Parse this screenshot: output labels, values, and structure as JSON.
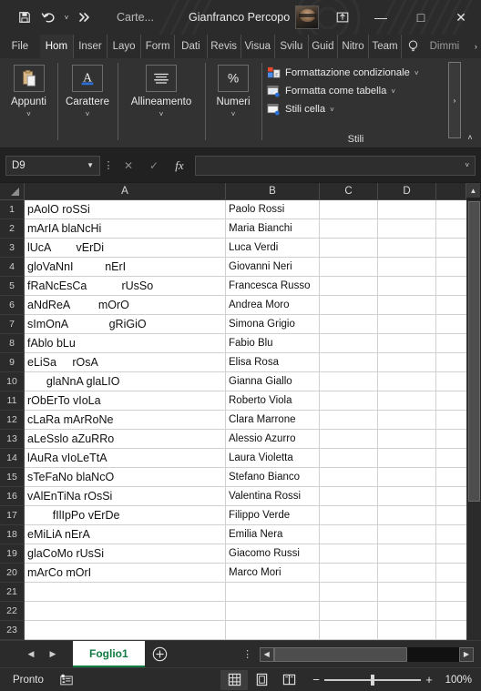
{
  "titlebar": {
    "save_icon": "save-icon",
    "undo_icon": "undo-icon",
    "undo_caret": "˅",
    "redo_icon": "redo-more-icon",
    "file_name": "Carte...",
    "user_name": "Gianfranco Percopo",
    "avatar": "user-avatar",
    "share_icon": "share-icon",
    "minimize": "—",
    "maximize": "□",
    "close": "✕"
  },
  "ribbon_tabs": {
    "items": [
      {
        "label": "File",
        "selected": false
      },
      {
        "label": "Hom",
        "selected": true
      },
      {
        "label": "Inser",
        "selected": false
      },
      {
        "label": "Layo",
        "selected": false
      },
      {
        "label": "Form",
        "selected": false
      },
      {
        "label": "Dati",
        "selected": false
      },
      {
        "label": "Revis",
        "selected": false
      },
      {
        "label": "Visua",
        "selected": false
      },
      {
        "label": "Svilu",
        "selected": false
      },
      {
        "label": "Guid",
        "selected": false
      },
      {
        "label": "Nitro",
        "selected": false
      },
      {
        "label": "Team",
        "selected": false
      }
    ],
    "bulb_icon": "lightbulb-icon",
    "tell_me": "Dimmi",
    "more": "›"
  },
  "ribbon": {
    "groups": [
      {
        "label": "Appunti",
        "icon": "clipboard-icon",
        "caret": "˅"
      },
      {
        "label": "Carattere",
        "icon": "font-A-icon",
        "caret": "˅"
      },
      {
        "label": "Allineamento",
        "icon": "align-center-icon",
        "caret": "˅"
      },
      {
        "label": "Numeri",
        "icon": "percent-icon",
        "caret": "˅"
      }
    ],
    "styles": {
      "title": "Stili",
      "items": [
        {
          "label": "Formattazione condizionale",
          "icon": "conditional-formatting-icon",
          "caret": "˅"
        },
        {
          "label": "Formatta come tabella",
          "icon": "format-as-table-icon",
          "caret": "˅"
        },
        {
          "label": "Stili cella",
          "icon": "cell-styles-icon",
          "caret": "˅"
        }
      ]
    },
    "scroll_more": "›",
    "collapse": "˄"
  },
  "formula_bar": {
    "name_box_value": "D9",
    "name_box_caret": "▼",
    "dots_icon": "⋮",
    "cancel_icon": "✕",
    "confirm_icon": "✓",
    "fx_icon": "fx",
    "formula_value": "",
    "expand_caret": "˅"
  },
  "grid": {
    "column_headers": [
      "A",
      "B",
      "C",
      "D"
    ],
    "row_numbers": [
      1,
      2,
      3,
      4,
      5,
      6,
      7,
      8,
      9,
      10,
      11,
      12,
      13,
      14,
      15,
      16,
      17,
      18,
      19,
      20,
      21,
      22,
      23
    ],
    "rows": [
      {
        "n": 1,
        "a": "pAolO roSSi",
        "b": "Paolo Rossi"
      },
      {
        "n": 2,
        "a": "mArIA blaNcHi",
        "b": "Maria Bianchi"
      },
      {
        "n": 3,
        "a": "lUcA        vErDi",
        "b": "Luca Verdi"
      },
      {
        "n": 4,
        "a": "gloVaNnI          nErI",
        "b": "Giovanni Neri"
      },
      {
        "n": 5,
        "a": "fRaNcEsCa           rUsSo",
        "b": "Francesca Russo"
      },
      {
        "n": 6,
        "a": "aNdReA         mOrO",
        "b": "Andrea Moro"
      },
      {
        "n": 7,
        "a": "sImOnA             gRiGiO",
        "b": "Simona Grigio"
      },
      {
        "n": 8,
        "a": "fAblo bLu",
        "b": "Fabio Blu"
      },
      {
        "n": 9,
        "a": "eLiSa     rOsA",
        "b": "Elisa Rosa"
      },
      {
        "n": 10,
        "a": "      glaNnA glaLIO",
        "b": "Gianna Giallo"
      },
      {
        "n": 11,
        "a": "rObErTo vIoLa",
        "b": "Roberto Viola"
      },
      {
        "n": 12,
        "a": "cLaRa mArRoNe",
        "b": "Clara Marrone"
      },
      {
        "n": 13,
        "a": "aLeSslo aZuRRo",
        "b": "Alessio Azurro"
      },
      {
        "n": 14,
        "a": "lAuRa vIoLeTtA",
        "b": "Laura Violetta"
      },
      {
        "n": 15,
        "a": "sTeFaNo blaNcO",
        "b": "Stefano Bianco"
      },
      {
        "n": 16,
        "a": "vAlEnTiNa rOsSi",
        "b": "Valentina Rossi"
      },
      {
        "n": 17,
        "a": "        fIlIpPo vErDe",
        "b": "Filippo Verde"
      },
      {
        "n": 18,
        "a": "eMiLiA nErA",
        "b": "Emilia Nera"
      },
      {
        "n": 19,
        "a": "glaCoMo rUsSi",
        "b": "Giacomo Russi"
      },
      {
        "n": 20,
        "a": "mArCo mOrI",
        "b": "Marco Mori"
      },
      {
        "n": 21,
        "a": "",
        "b": ""
      },
      {
        "n": 22,
        "a": "",
        "b": ""
      },
      {
        "n": 23,
        "a": "",
        "b": ""
      }
    ],
    "scroll_up": "▲",
    "scroll_down": "▼"
  },
  "sheet_tabs": {
    "prev": "◀",
    "next": "▶",
    "tabs": [
      {
        "label": "Foglio1",
        "active": true
      }
    ],
    "add_icon": "add-sheet-icon",
    "dots_icon": "⋮",
    "hs_left": "◀",
    "hs_right": "▶"
  },
  "status_bar": {
    "status_text": "Pronto",
    "accessibility_icon": "accessibility-icon",
    "views": [
      {
        "name": "normal-view",
        "icon": "grid-view-icon",
        "active": true
      },
      {
        "name": "page-layout-view",
        "icon": "page-layout-icon",
        "active": false
      },
      {
        "name": "page-break-view",
        "icon": "page-break-icon",
        "active": false
      }
    ],
    "zoom_out": "−",
    "zoom_in": "+",
    "zoom_level": "100%"
  },
  "colors": {
    "accent_green": "#107c41",
    "titlebar_bg": "#2b2b2b",
    "ribbon_bg": "#323232",
    "cell_bg": "#ffffff"
  }
}
